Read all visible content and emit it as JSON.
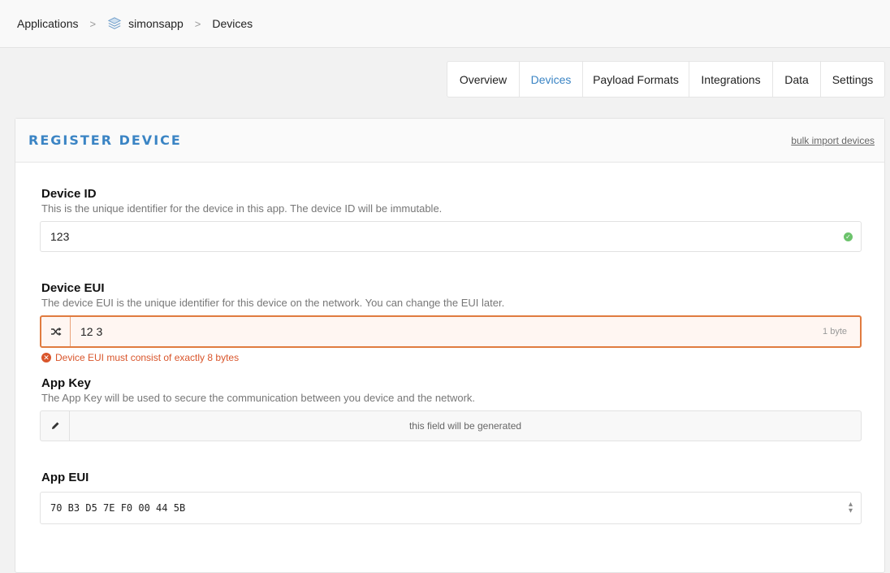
{
  "breadcrumb": {
    "items": [
      "Applications",
      "simonsapp",
      "Devices"
    ],
    "separator": ">"
  },
  "tabs": [
    {
      "label": "Overview"
    },
    {
      "label": "Devices"
    },
    {
      "label": "Payload Formats"
    },
    {
      "label": "Integrations"
    },
    {
      "label": "Data"
    },
    {
      "label": "Settings"
    }
  ],
  "card": {
    "title": "REGISTER DEVICE",
    "bulk_link": "bulk import devices"
  },
  "device_id": {
    "label": "Device ID",
    "description": "This is the unique identifier for the device in this app. The device ID will be immutable.",
    "value": "123"
  },
  "device_eui": {
    "label": "Device EUI",
    "description": "The device EUI is the unique identifier for this device on the network. You can change the EUI later.",
    "value": "12 3",
    "suffix": "1 byte",
    "error": "Device EUI must consist of exactly 8 bytes"
  },
  "app_key": {
    "label": "App Key",
    "description": "The App Key will be used to secure the communication between you device and the network.",
    "placeholder": "this field will be generated"
  },
  "app_eui": {
    "label": "App EUI",
    "value": "70 B3 D5 7E F0 00 44 5B"
  },
  "colors": {
    "accent": "#3a84c4",
    "error": "#d9552b",
    "success": "#6cc36c"
  },
  "icons": {
    "app": "stack-layers-icon",
    "shuffle": "shuffle-icon",
    "edit": "pencil-icon",
    "valid": "check-circle-icon",
    "error": "error-circle-icon",
    "select": "chevron-updown-icon"
  }
}
